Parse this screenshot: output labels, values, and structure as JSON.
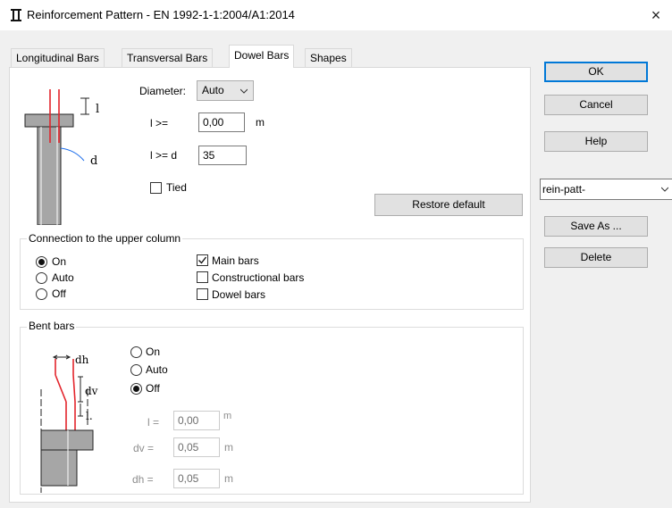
{
  "window": {
    "title": "Reinforcement Pattern - EN 1992-1-1:2004/A1:2014",
    "close_glyph": "×"
  },
  "tabs": [
    {
      "label": "Longitudinal Bars",
      "active": false
    },
    {
      "label": "Transversal Bars",
      "active": false
    },
    {
      "label": "Dowel Bars",
      "active": true
    },
    {
      "label": "Shapes",
      "active": false
    }
  ],
  "dowel": {
    "diameter_label": "Diameter:",
    "diameter_value": "Auto",
    "l_ge_label": "l  >=",
    "l_ge_value": "0,00",
    "l_ge_unit": "m",
    "l_ge_d_label": "l >= d",
    "l_ge_d_value": "35",
    "tied_label": "Tied",
    "tied_checked": false,
    "diagram_l": "l",
    "diagram_d": "d"
  },
  "restore_default_label": "Restore default",
  "connection": {
    "title": "Connection to the upper column",
    "radios": [
      {
        "label": "On",
        "checked": true
      },
      {
        "label": "Auto",
        "checked": false
      },
      {
        "label": "Off",
        "checked": false
      }
    ],
    "checks": [
      {
        "label": "Main bars",
        "checked": true
      },
      {
        "label": "Constructional bars",
        "checked": false
      },
      {
        "label": "Dowel bars",
        "checked": false
      }
    ]
  },
  "bent": {
    "title": "Bent bars",
    "radios": [
      {
        "label": "On",
        "checked": false
      },
      {
        "label": "Auto",
        "checked": false
      },
      {
        "label": "Off",
        "checked": true
      }
    ],
    "l_label": "l =",
    "l_value": "0,00",
    "l_unit": "m",
    "dv_label": "dv =",
    "dv_value": "0,05",
    "dv_unit": "m",
    "dh_label": "dh =",
    "dh_value": "0,05",
    "dh_unit": "m",
    "diagram_dh": "dh",
    "diagram_dv": "dv",
    "diagram_l": "l."
  },
  "buttons": {
    "ok": "OK",
    "cancel": "Cancel",
    "help": "Help",
    "save_as": "Save As ...",
    "delete": "Delete"
  },
  "pattern_select": "rein-patt-",
  "colors": {
    "accent": "#0078d7",
    "bar_red": "#e3242b",
    "concrete": "#a6a6a6"
  }
}
